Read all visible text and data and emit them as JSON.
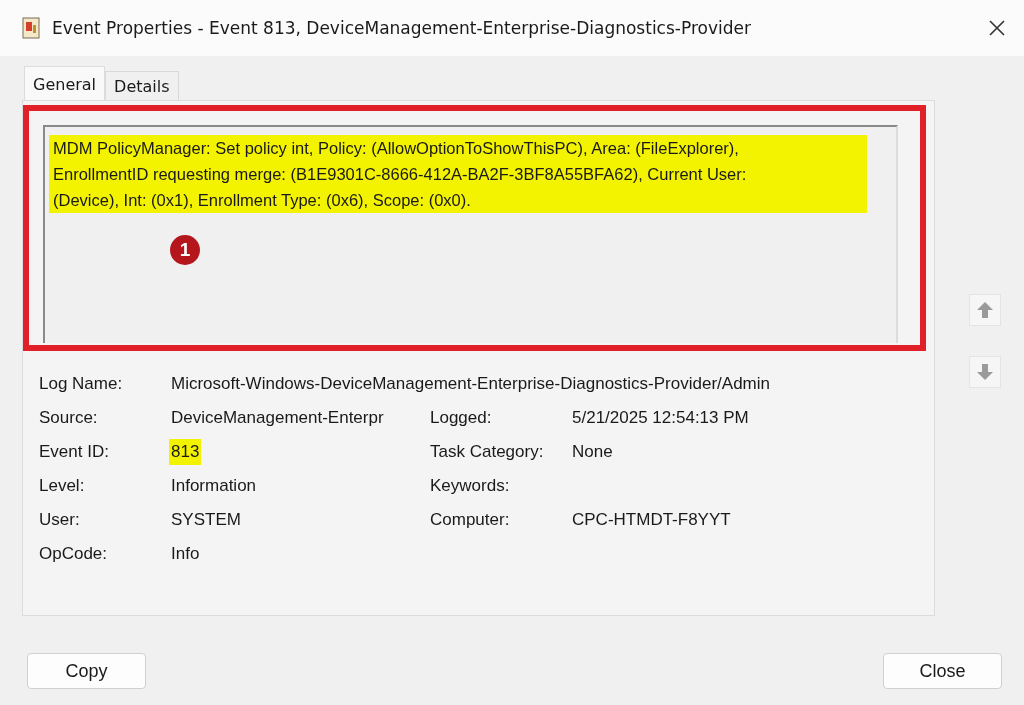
{
  "window": {
    "title": "Event Properties - Event 813, DeviceManagement-Enterprise-Diagnostics-Provider"
  },
  "tabs": [
    {
      "label": "General",
      "selected": true
    },
    {
      "label": "Details",
      "selected": false
    }
  ],
  "message": {
    "lines": [
      "MDM PolicyManager: Set policy int, Policy: (AllowOptionToShowThisPC), Area: (FileExplorer),",
      "EnrollmentID requesting merge: (B1E9301C-8666-412A-BA2F-3BF8A55BFA62), Current User:",
      "(Device), Int: (0x1), Enrollment Type: (0x6), Scope: (0x0)."
    ],
    "highlighted": true
  },
  "annotation": {
    "outlined": true,
    "callout": "1"
  },
  "field_rows": [
    [
      {
        "label": "Log Name:",
        "value": "Microsoft-Windows-DeviceManagement-Enterprise-Diagnostics-Provider/Admin",
        "highlighted": false
      }
    ],
    [
      {
        "label": "Source:",
        "value": "DeviceManagement-Enterpr",
        "highlighted": false
      },
      {
        "label": "Logged:",
        "value": "5/21/2025 12:54:13 PM",
        "highlighted": false
      }
    ],
    [
      {
        "label": "Event ID:",
        "value": "813",
        "highlighted": true
      },
      {
        "label": "Task Category:",
        "value": "None",
        "highlighted": false
      }
    ],
    [
      {
        "label": "Level:",
        "value": "Information",
        "highlighted": false
      },
      {
        "label": "Keywords:"
      }
    ],
    [
      {
        "label": "User:",
        "value": "SYSTEM",
        "highlighted": false
      },
      {
        "label": "Computer:",
        "value": "CPC-HTMDT-F8YYT",
        "highlighted": false
      }
    ],
    [
      {
        "label": "OpCode:",
        "value": "Info",
        "highlighted": false
      }
    ]
  ],
  "buttons": [
    "Copy",
    "Close"
  ]
}
